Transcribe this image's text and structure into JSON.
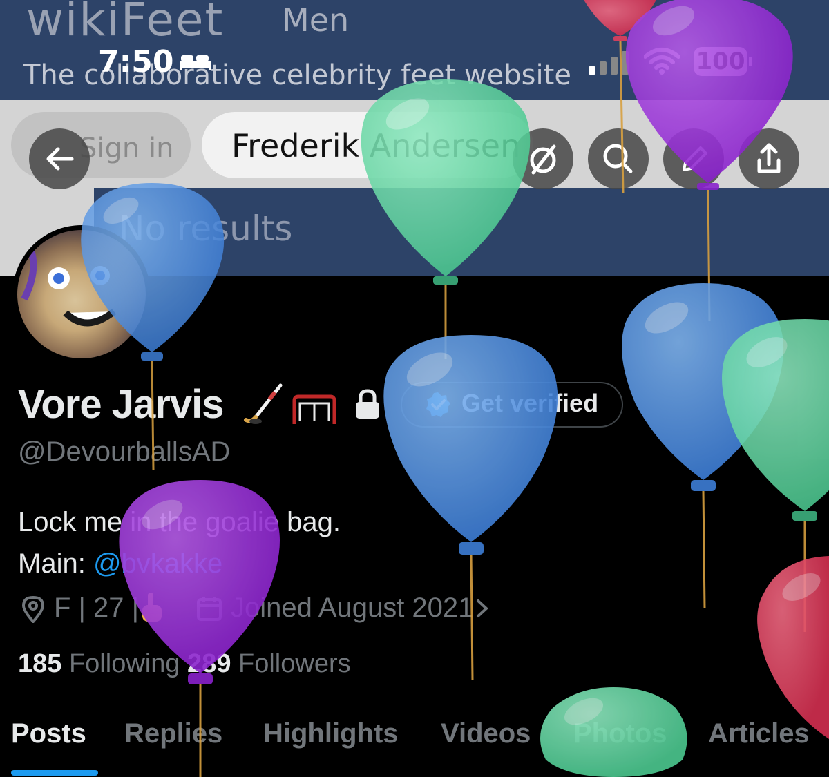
{
  "site": {
    "logo": "wikiFeet",
    "logo_suffix": "Men",
    "tagline": "The collaborative celebrity feet website",
    "sign_in_label": "Sign in",
    "search_value": "Frederik Andersen",
    "no_results_label": "No results"
  },
  "status_bar": {
    "time": "7:50",
    "battery": "100"
  },
  "profile": {
    "display_name": "Vore Jarvis",
    "get_verified_label": "Get verified",
    "handle": "@DevourballsAD",
    "bio_line1": "Lock me in the goalie bag.",
    "bio_main_label": "Main: ",
    "bio_main_link": "@bvkakke",
    "location_text": "F | 27 |",
    "joined_text": "Joined August 2021",
    "following_count": "185",
    "following_label": " Following  ",
    "followers_count": "289",
    "followers_label": " Followers"
  },
  "tabs": [
    {
      "label": "Posts",
      "active": true
    },
    {
      "label": "Replies",
      "active": false
    },
    {
      "label": "Highlights",
      "active": false
    },
    {
      "label": "Videos",
      "active": false
    },
    {
      "label": "Photos",
      "active": false
    },
    {
      "label": "Articles",
      "active": false
    }
  ],
  "icons": [
    "back-arrow-icon",
    "hide-icon",
    "search-icon",
    "edit-icon",
    "share-icon",
    "lock-icon",
    "verified-badge-icon",
    "location-pin-icon",
    "calendar-icon",
    "chevron-right-icon"
  ],
  "colors": {
    "accent": "#1d9bf0",
    "header_navy": "#2d4368",
    "balloon_blue": "#4a8fe0",
    "balloon_green": "#5dd6a0",
    "balloon_purple": "#9a35d8",
    "balloon_red": "#e0405e"
  }
}
